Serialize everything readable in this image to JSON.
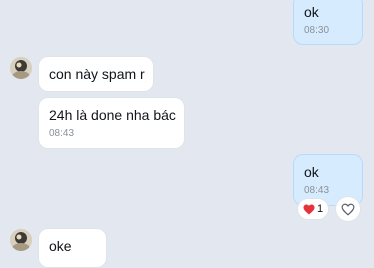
{
  "messages": [
    {
      "text": "ok",
      "time": "08:30",
      "direction": "sent"
    },
    {
      "text": "con này spam r",
      "direction": "received"
    },
    {
      "text": "24h là done nha bác",
      "time": "08:43",
      "direction": "received"
    },
    {
      "text": "ok",
      "time": "08:43",
      "direction": "sent"
    },
    {
      "text": "oke",
      "direction": "received"
    }
  ],
  "reactions": {
    "icon": "heart-icon",
    "count": "1",
    "color": "#e5323b"
  },
  "react_button_icon": "heart-outline-icon",
  "colors": {
    "background": "#e3e8f0",
    "sent_bubble": "#d6ecfe",
    "received_bubble": "#ffffff",
    "time_text": "#8a9099"
  }
}
